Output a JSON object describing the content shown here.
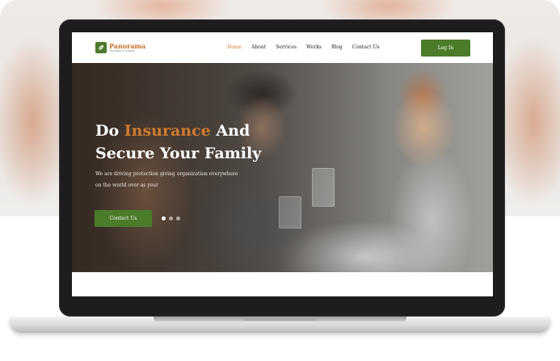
{
  "navbar": {
    "logo": {
      "name": "Panorama",
      "tagline": "Insurance & Finance",
      "icon": "leaf-icon"
    },
    "menu": [
      {
        "label": "Home",
        "active": true
      },
      {
        "label": "About",
        "active": false
      },
      {
        "label": "Services",
        "active": false
      },
      {
        "label": "Works",
        "active": false
      },
      {
        "label": "Blog",
        "active": false
      },
      {
        "label": "Contact Us",
        "active": false
      }
    ],
    "login_label": "Log In"
  },
  "hero": {
    "title_part1": "Do ",
    "title_accent": "Insurance",
    "title_part2": " And",
    "title_line2": "Secure Your Family",
    "subtitle_line1": "We are driving protection giving organization everywhere",
    "subtitle_line2": "on the world over as your",
    "cta_label": "Contact Us",
    "slider": {
      "count": 3,
      "active_index": 0
    }
  },
  "colors": {
    "accent_orange": "#d07a2f",
    "brand_green": "#4b7c2a",
    "laptop_bezel": "#1d1d1f"
  }
}
